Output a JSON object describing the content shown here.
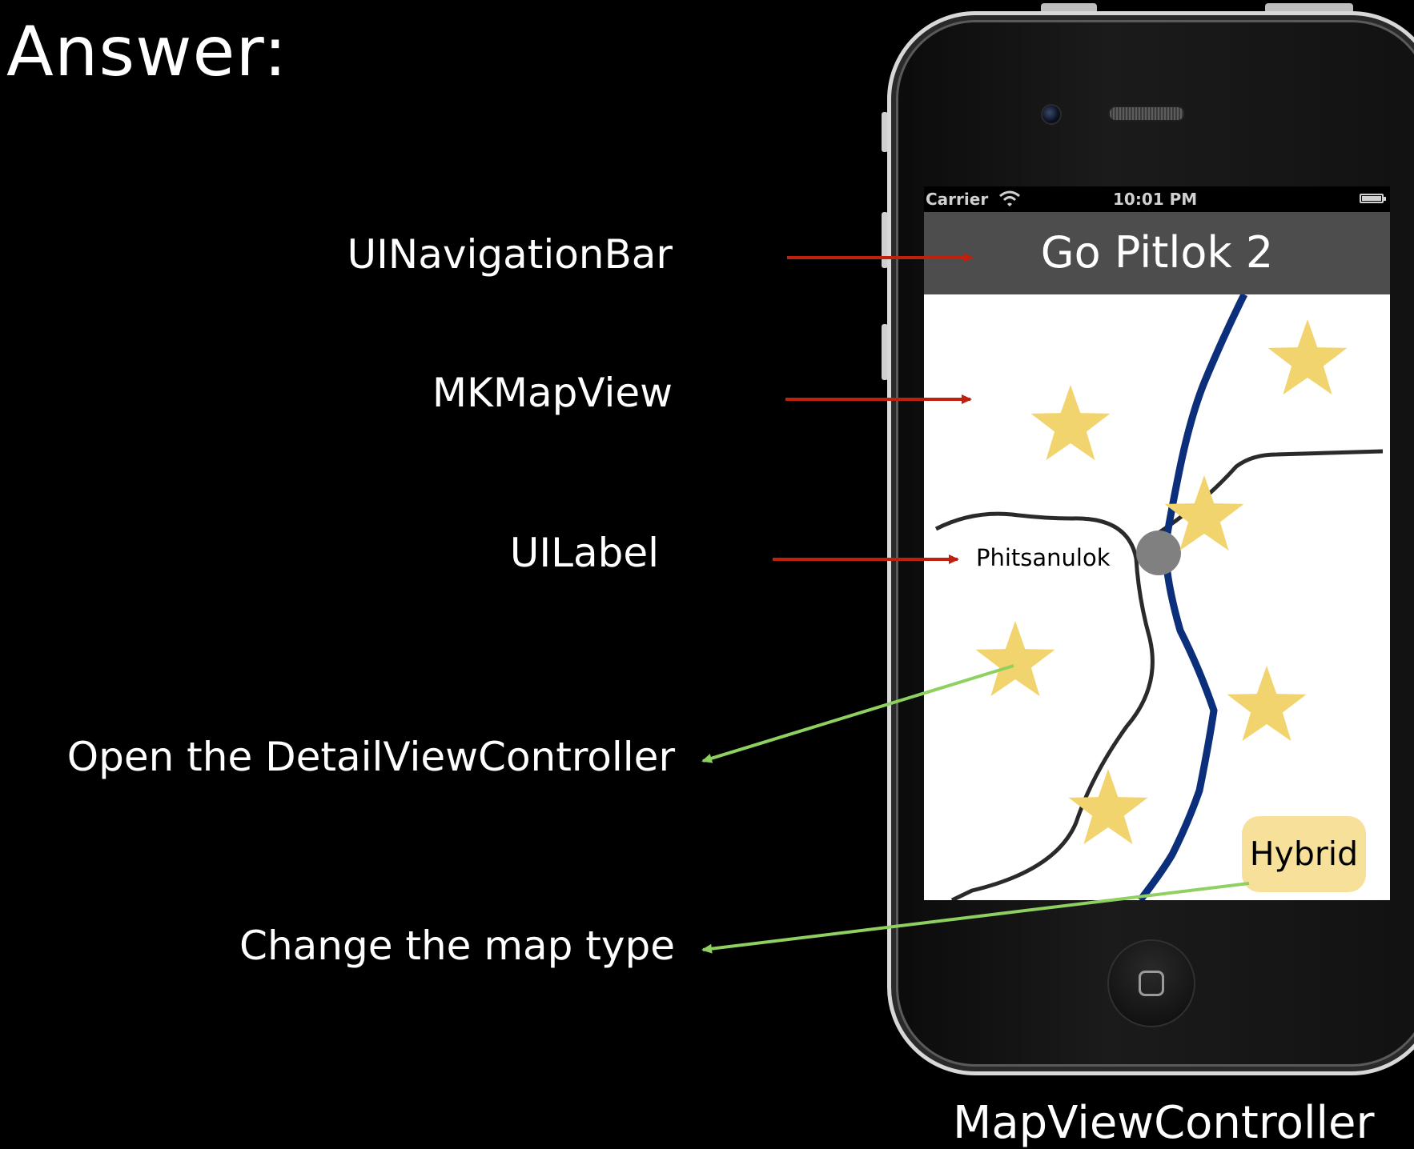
{
  "slide": {
    "title": "Answer:",
    "caption": "MapViewController"
  },
  "callouts": {
    "navbar": "UINavigationBar",
    "mapview": "MKMapView",
    "uilabel": "UILabel",
    "open_detail": "Open the DetailViewController",
    "map_type": "Change the map type"
  },
  "phone": {
    "status_bar": {
      "carrier": "Carrier",
      "time": "10:01 PM"
    },
    "nav_title": "Go Pitlok 2",
    "map": {
      "place_label": "Phitsanulok",
      "hybrid_button": "Hybrid"
    }
  },
  "colors": {
    "background": "#000000",
    "navbar": "#4d4d4d",
    "river": "#0b2f7a",
    "road": "#2a2a2a",
    "star": "#f2d46e",
    "hybrid_button": "#f7e19a",
    "arrow_red": "#c0200c",
    "arrow_green": "#8fd160",
    "marker": "#808080"
  }
}
